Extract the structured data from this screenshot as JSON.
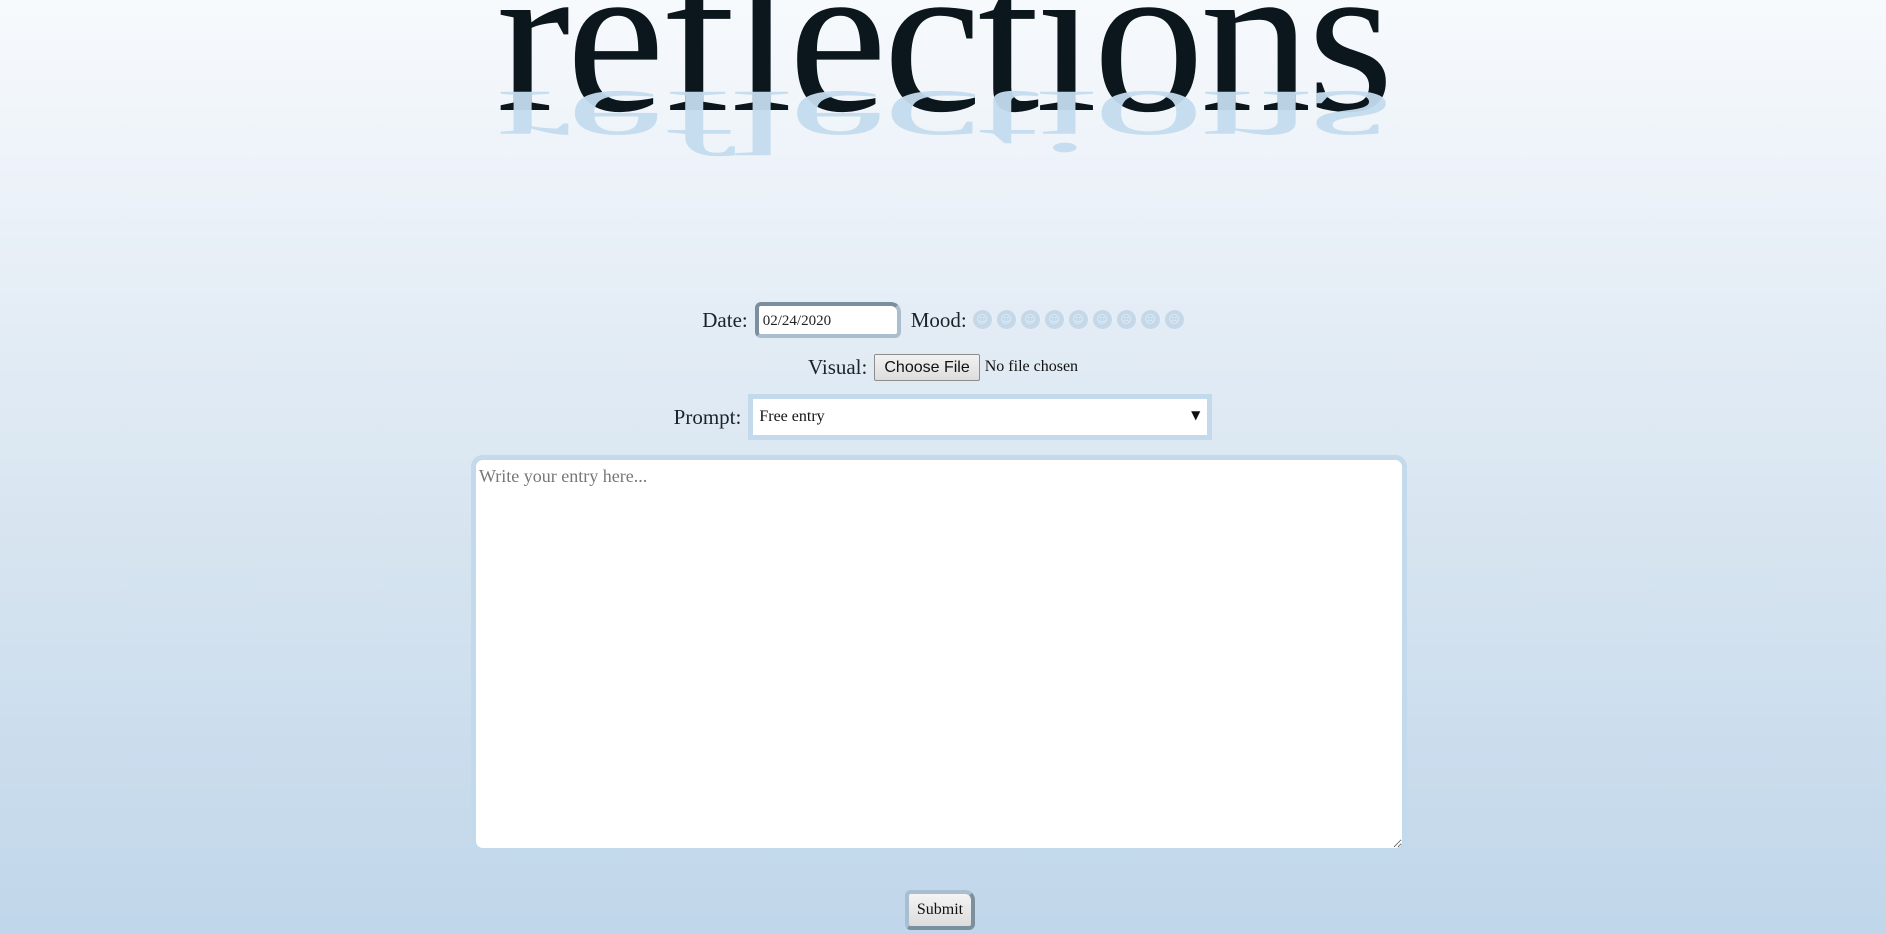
{
  "logo": {
    "text": "reflections"
  },
  "form": {
    "date": {
      "label": "Date:",
      "value": "02/24/2020"
    },
    "mood": {
      "label": "Mood:",
      "faces": [
        {
          "icon": "smiling-face-icon",
          "glyph": "☺"
        },
        {
          "icon": "surprised-face-icon",
          "glyph": "☺"
        },
        {
          "icon": "grinning-face-icon",
          "glyph": "☺"
        },
        {
          "icon": "neutral-face-icon",
          "glyph": "☺"
        },
        {
          "icon": "sunglasses-face-icon",
          "glyph": "☺"
        },
        {
          "icon": "slight-smile-face-icon",
          "glyph": "☺"
        },
        {
          "icon": "frowning-face-icon",
          "glyph": "☹"
        },
        {
          "icon": "crying-face-icon",
          "glyph": "☹"
        },
        {
          "icon": "angry-face-icon",
          "glyph": "☹"
        }
      ]
    },
    "visual": {
      "label": "Visual:",
      "button_label": "Choose File",
      "status": "No file chosen"
    },
    "prompt": {
      "label": "Prompt:",
      "selected": "Free entry",
      "arrow": "▼"
    },
    "entry": {
      "placeholder": "Write your entry here..."
    },
    "submit_label": "Submit"
  },
  "colors": {
    "accent_border": "#c3d9ec",
    "dark_border": "#7b8f9e",
    "logo_text": "#0b171d",
    "logo_reflection": "#c3dcee"
  }
}
